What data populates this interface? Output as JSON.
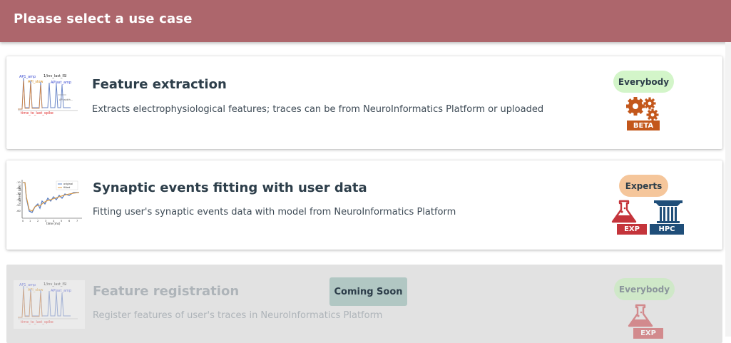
{
  "header": {
    "title": "Please select a use case"
  },
  "colors": {
    "header_bg": "#ad666c",
    "everybody_badge": "#d3f5c9",
    "experts_badge": "#f5c69b",
    "beta_orange": "#c3571b",
    "exp_red": "#c4343b",
    "hpc_blue": "#1f4e79",
    "coming_soon_bg": "#b1c7c3"
  },
  "use_cases": [
    {
      "title": "Feature extraction",
      "description": "Extracts electrophysiological features; traces can be from NeuroInformatics Platform or uploaded",
      "audience": "Everybody",
      "tags": [
        "BETA"
      ],
      "icons": [
        "gears-icon"
      ]
    },
    {
      "title": "Synaptic events fitting with user data",
      "description": "Fitting user's synaptic events data with model from NeuroInformatics Platform",
      "audience": "Experts",
      "tags": [
        "EXP",
        "HPC"
      ],
      "icons": [
        "flask-icon",
        "column-icon"
      ]
    },
    {
      "title": "Feature registration",
      "description": "Register features of user's traces in NeuroInformatics Platform",
      "audience": "Everybody",
      "status": "Coming Soon",
      "tags": [
        "EXP"
      ],
      "icons": [
        "flask-icon"
      ]
    }
  ]
}
